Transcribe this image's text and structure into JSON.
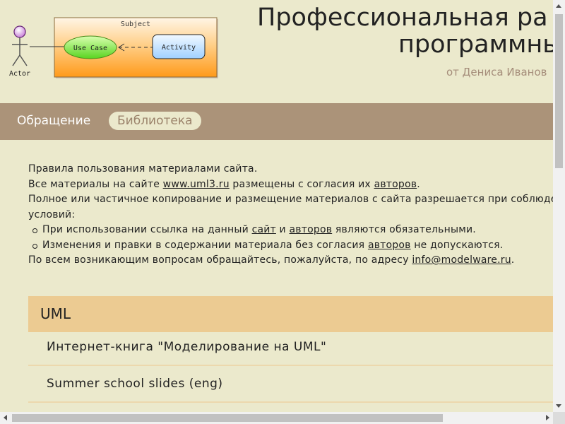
{
  "header": {
    "title_line1": "Профессиональная ра",
    "title_line2": "программны",
    "subtitle": "от Дениса Иванов"
  },
  "logo": {
    "subject_label": "Subject",
    "actor_label": "Actor",
    "use_case_label": "Use Case",
    "activity_label": "Activity"
  },
  "nav": {
    "items": [
      {
        "label": "Обращение"
      },
      {
        "label": "Библиотека"
      }
    ]
  },
  "content": {
    "line1": "Правила пользования материалами сайта.",
    "line2_pre": "Все материалы на сайте ",
    "line2_link1": "www.uml3.ru",
    "line2_mid": " размещены с согласия их ",
    "line2_link2": "авторов",
    "line2_post": ".",
    "line3": "Полное или частичное копирование и размещение материалов с сайта разрешается при соблюде",
    "line4": "условий:",
    "bullet1_pre": "При использовании ссылка на данный ",
    "bullet1_link1": "сайт",
    "bullet1_mid": " и ",
    "bullet1_link2": "авторов",
    "bullet1_post": " являются обязательными.",
    "bullet2_pre": "Изменения и правки в содержании материала без согласия ",
    "bullet2_link": "авторов",
    "bullet2_post": " не допускаются.",
    "line5_pre": "По всем возникающим вопросам обращайтесь, пожалуйста, по адресу ",
    "line5_link": "info@modelware.ru",
    "line5_post": "."
  },
  "library": {
    "section_title": "UML",
    "items": [
      {
        "label": "Интернет-книга \"Моделирование на UML\""
      },
      {
        "label": "Summer school slides (eng)"
      }
    ]
  },
  "colors": {
    "page_bg": "#ebe9cc",
    "nav_bg": "#ab9379",
    "section_bg": "#eccb92",
    "subtitle": "#a58d7a"
  }
}
